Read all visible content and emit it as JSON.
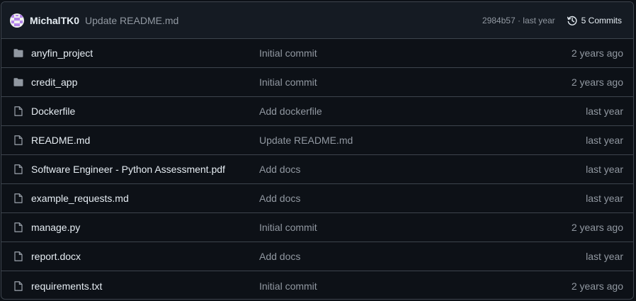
{
  "latest_commit": {
    "author": "MichalTK0",
    "message": "Update README.md",
    "hash": "2984b57",
    "separator": " · ",
    "time": "last year",
    "commits_label": "5 Commits"
  },
  "files": [
    {
      "type": "folder",
      "icon": "folder-icon",
      "name": "anyfin_project",
      "message": "Initial commit",
      "date": "2 years ago"
    },
    {
      "type": "folder",
      "icon": "folder-icon",
      "name": "credit_app",
      "message": "Initial commit",
      "date": "2 years ago"
    },
    {
      "type": "file",
      "icon": "file-icon",
      "name": "Dockerfile",
      "message": "Add dockerfile",
      "date": "last year"
    },
    {
      "type": "file",
      "icon": "file-icon",
      "name": "README.md",
      "message": "Update README.md",
      "date": "last year"
    },
    {
      "type": "file",
      "icon": "file-icon",
      "name": "Software Engineer - Python Assessment.pdf",
      "message": "Add docs",
      "date": "last year"
    },
    {
      "type": "file",
      "icon": "file-icon",
      "name": "example_requests.md",
      "message": "Add docs",
      "date": "last year"
    },
    {
      "type": "file",
      "icon": "file-icon",
      "name": "manage.py",
      "message": "Initial commit",
      "date": "2 years ago"
    },
    {
      "type": "file",
      "icon": "file-icon",
      "name": "report.docx",
      "message": "Add docs",
      "date": "last year"
    },
    {
      "type": "file",
      "icon": "file-icon",
      "name": "requirements.txt",
      "message": "Initial commit",
      "date": "2 years ago"
    }
  ],
  "colors": {
    "background": "#0d1117",
    "header_background": "#151b23",
    "border": "#3d444d",
    "text": "#e6edf3",
    "muted_text": "#9198a1",
    "folder_icon": "#9198a1",
    "avatar_accent": "#b486ea"
  }
}
